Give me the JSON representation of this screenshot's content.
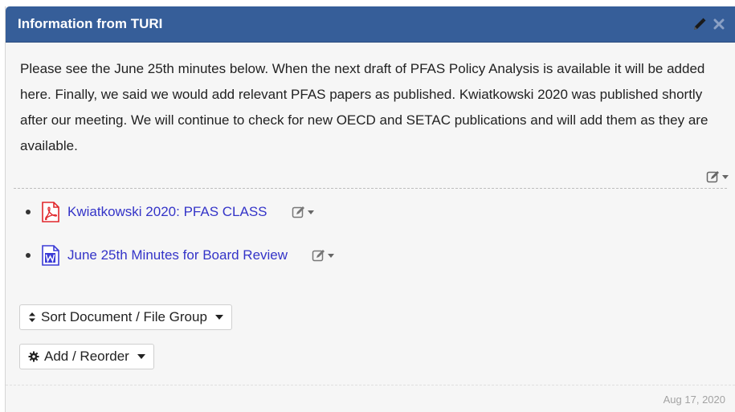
{
  "panel": {
    "title": "Information from TURI",
    "icons": {
      "edit": "pencil-icon",
      "close": "close-icon"
    }
  },
  "intro": {
    "text": "Please see the June 25th minutes below. When the next draft of  PFAS Policy Analysis is available it will be added here. Finally, we said we would add relevant PFAS papers as published. Kwiatkowski 2020 was published shortly after our meeting. We will continue to check for new OECD and SETAC publications and will add them as they are available."
  },
  "files": [
    {
      "title": "Kwiatkowski 2020: PFAS CLASS",
      "icon": "pdf-file-icon",
      "icon_color": "#e0262b"
    },
    {
      "title": "June 25th Minutes for Board Review",
      "icon": "word-file-icon",
      "icon_color": "#3b3bd6"
    }
  ],
  "buttons": {
    "sort_label": "Sort Document / File Group",
    "add_label": "Add / Reorder"
  },
  "footer": {
    "date": "Aug 17, 2020"
  },
  "colors": {
    "header": "#365e99",
    "link": "#3434c8",
    "panel_bg": "#f6f6f6"
  }
}
